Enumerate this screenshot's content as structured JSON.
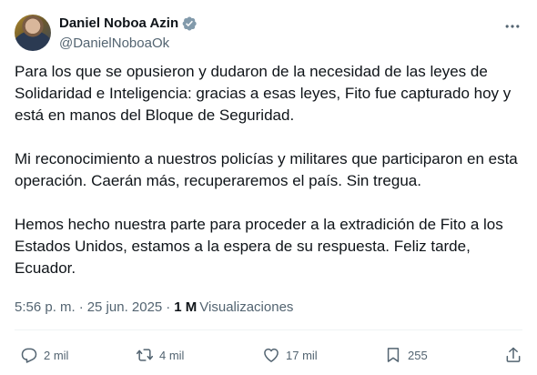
{
  "author": {
    "display_name": "Daniel Noboa Azin",
    "handle": "@DanielNoboaOk",
    "verified": true,
    "verified_color": "#829aab"
  },
  "tweet": {
    "paragraphs": [
      "Para los que se opusieron y dudaron de la necesidad de las leyes de Solidaridad e Inteligencia: gracias a esas leyes, Fito fue capturado hoy y está en manos del Bloque de Seguridad.",
      "Mi reconocimiento a nuestros policías y militares que participaron en esta operación. Caerán más, recuperaremos el país. Sin tregua.",
      "Hemos hecho nuestra parte para proceder a la extradición de Fito a los Estados Unidos, estamos a la espera de su respuesta. Feliz tarde, Ecuador."
    ],
    "time": "5:56 p. m.",
    "date": "25 jun. 2025",
    "separator": "·",
    "views_count": "1 M",
    "views_label": "Visualizaciones"
  },
  "actions": {
    "reply_count": "2 mil",
    "retweet_count": "4 mil",
    "like_count": "17 mil",
    "bookmark_count": "255"
  },
  "icons": {
    "more": "more-icon",
    "reply": "reply-icon",
    "retweet": "retweet-icon",
    "like": "heart-icon",
    "bookmark": "bookmark-icon",
    "share": "share-icon",
    "verified": "verified-badge-icon"
  },
  "colors": {
    "text": "#0f1419",
    "secondary": "#536471",
    "divider": "#eff3f4"
  }
}
